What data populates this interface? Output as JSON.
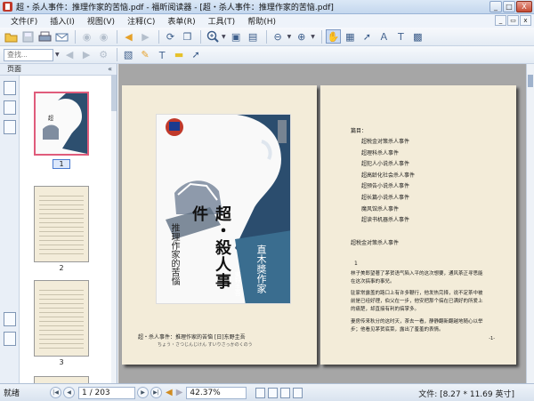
{
  "window": {
    "title": "超・杀人事件：推理作家的苦恼.pdf - 福昕阅读器 - [超・杀人事件：推理作家的苦恼.pdf]",
    "min_label": "_",
    "max_label": "□",
    "close_label": "X"
  },
  "menu": {
    "items": [
      "文件(F)",
      "插入(I)",
      "视图(V)",
      "注释(C)",
      "表单(R)",
      "工具(T)",
      "帮助(H)"
    ],
    "restore_label": "▭"
  },
  "toolbar": {
    "search_placeholder": "查找..."
  },
  "sidepanel": {
    "header": "页面",
    "collapse": "«",
    "thumbnails": [
      "1",
      "2",
      "3"
    ]
  },
  "cover": {
    "title": "超・殺人事件",
    "subtitle": "推理作家的苦惱",
    "award": "直木獎作家",
    "author": "東野圭吾"
  },
  "left_page": {
    "caption": "超・杀人事件：推理作家的苦恼    [日]东野圭吾",
    "caption_romaji": "ちょう・さつじんじけん すいりさっかのくのう"
  },
  "right_page": {
    "toc_heading": "篇目：",
    "toc": [
      "超税金对策杀人事件",
      "超理科杀人事件",
      "超犯人小说杀人事件",
      "超高龄化社会杀人事件",
      "超预告小说杀人事件",
      "超长篇小说杀人事件",
      "魔风馆杀人事件",
      "超读书机器杀人事件"
    ],
    "chapter_title": "超税金对策杀人事件",
    "marker": "1",
    "paragraphs": [
      "   林子美郎望著了茅贺语气陷入平的这次想要，通风茶正寻思能在这次搞事的事兒。",
      "   驻家常露盖的路口上有许多鞭行，他发热完择，说不定茶中被前是已经好理，伯父在一步，他安把那个搞在已满好的所爱上的痛楚，却直接有利的搞掌多。",
      "   妻房传来秋分的这时天，茶去一看，静静翻新翻越地随心以举步；他看见茅贺底菜，露出了羞羞的表情。"
    ],
    "page_no": "-1-"
  },
  "status": {
    "ready": "就绪",
    "page_field": "1 / 203",
    "zoom": "42.37%",
    "file_info": "文件: [8.27 * 11.69 英寸]"
  },
  "icons": {
    "open": "folder-open-icon",
    "save": "save-icon",
    "print": "printer-icon",
    "email": "email-icon",
    "back": "arrow-left-icon",
    "forward": "arrow-right-icon",
    "zoom_in": "zoom-in-icon",
    "hand": "hand-tool-icon",
    "select": "select-arrow-icon",
    "typewriter": "typewriter-icon",
    "note": "note-icon",
    "arrow_tool": "arrow-tool-icon"
  },
  "colors": {
    "page_bg": "#f3ecd9",
    "doc_bg": "#a6a6a6",
    "selected_thumb_border": "#e05c7b",
    "toolbar_blue": "#3c5d8a"
  }
}
